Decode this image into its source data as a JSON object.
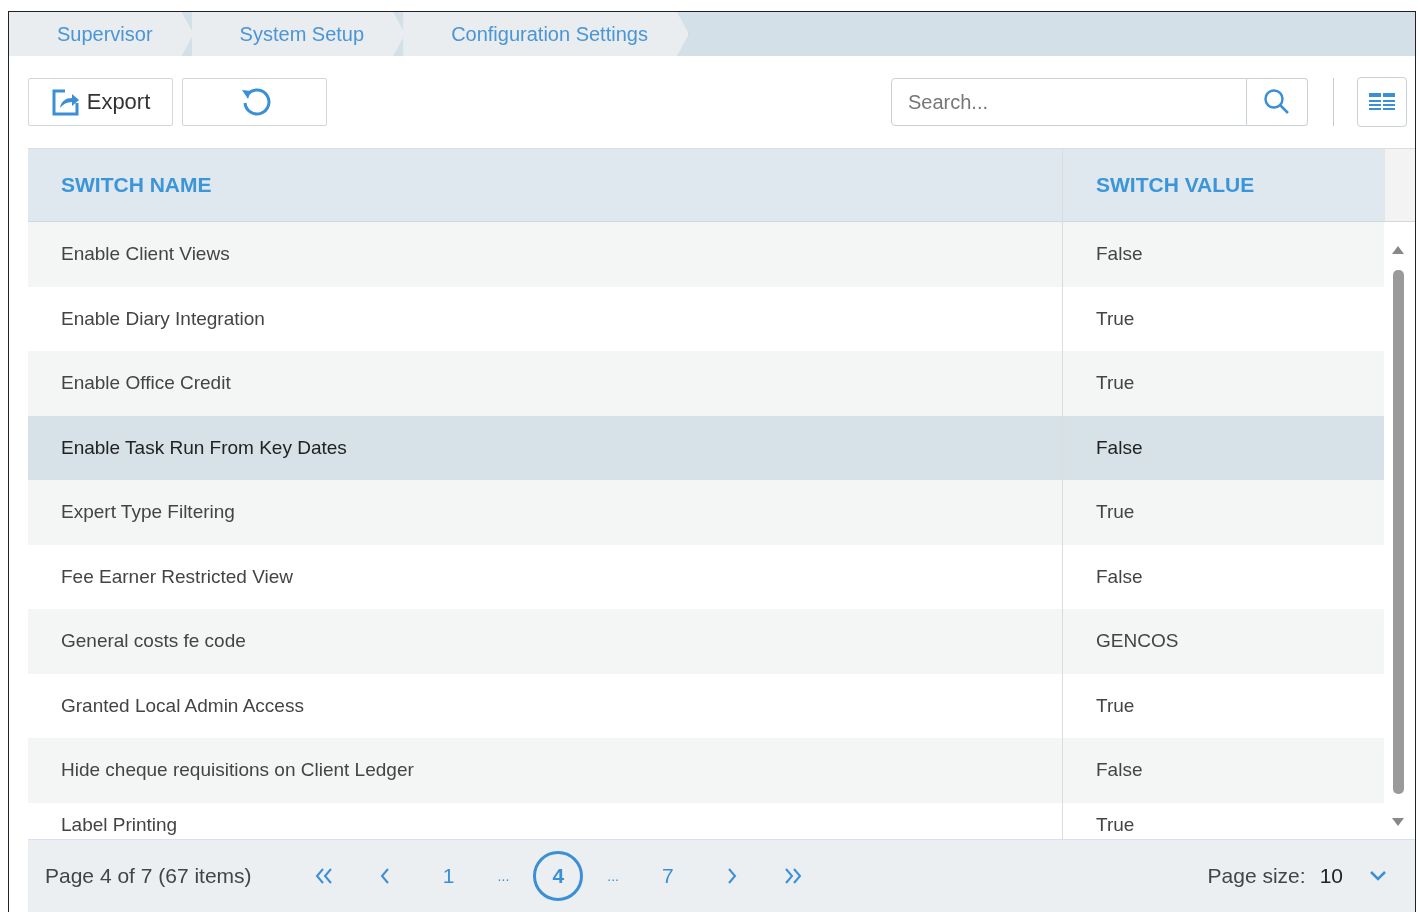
{
  "breadcrumbs": [
    {
      "label": "Supervisor"
    },
    {
      "label": "System Setup"
    },
    {
      "label": "Configuration Settings"
    }
  ],
  "toolbar": {
    "export_label": "Export",
    "search": {
      "placeholder": "Search..."
    }
  },
  "table": {
    "columns": [
      "SWITCH NAME",
      "SWITCH VALUE"
    ],
    "rows": [
      {
        "name": "Enable Client Views",
        "value": "False",
        "selected": false
      },
      {
        "name": "Enable Diary Integration",
        "value": "True",
        "selected": false
      },
      {
        "name": "Enable Office Credit",
        "value": "True",
        "selected": false
      },
      {
        "name": "Enable Task Run From Key Dates",
        "value": "False",
        "selected": true
      },
      {
        "name": "Expert Type Filtering",
        "value": "True",
        "selected": false
      },
      {
        "name": "Fee Earner Restricted View",
        "value": "False",
        "selected": false
      },
      {
        "name": "General costs fe code",
        "value": "GENCOS",
        "selected": false
      },
      {
        "name": "Granted Local Admin Access",
        "value": "True",
        "selected": false
      },
      {
        "name": "Hide cheque requisitions on Client Ledger",
        "value": "False",
        "selected": false
      },
      {
        "name": "Label Printing",
        "value": "True",
        "selected": false
      }
    ]
  },
  "pager": {
    "summary": "Page 4 of 7 (67 items)",
    "pages": [
      {
        "kind": "page",
        "label": "1",
        "selected": false
      },
      {
        "kind": "ellipsis",
        "label": "..."
      },
      {
        "kind": "page",
        "label": "4",
        "selected": true
      },
      {
        "kind": "ellipsis",
        "label": "..."
      },
      {
        "kind": "page",
        "label": "7",
        "selected": false
      }
    ],
    "page_size_label": "Page size:",
    "page_size": "10"
  }
}
